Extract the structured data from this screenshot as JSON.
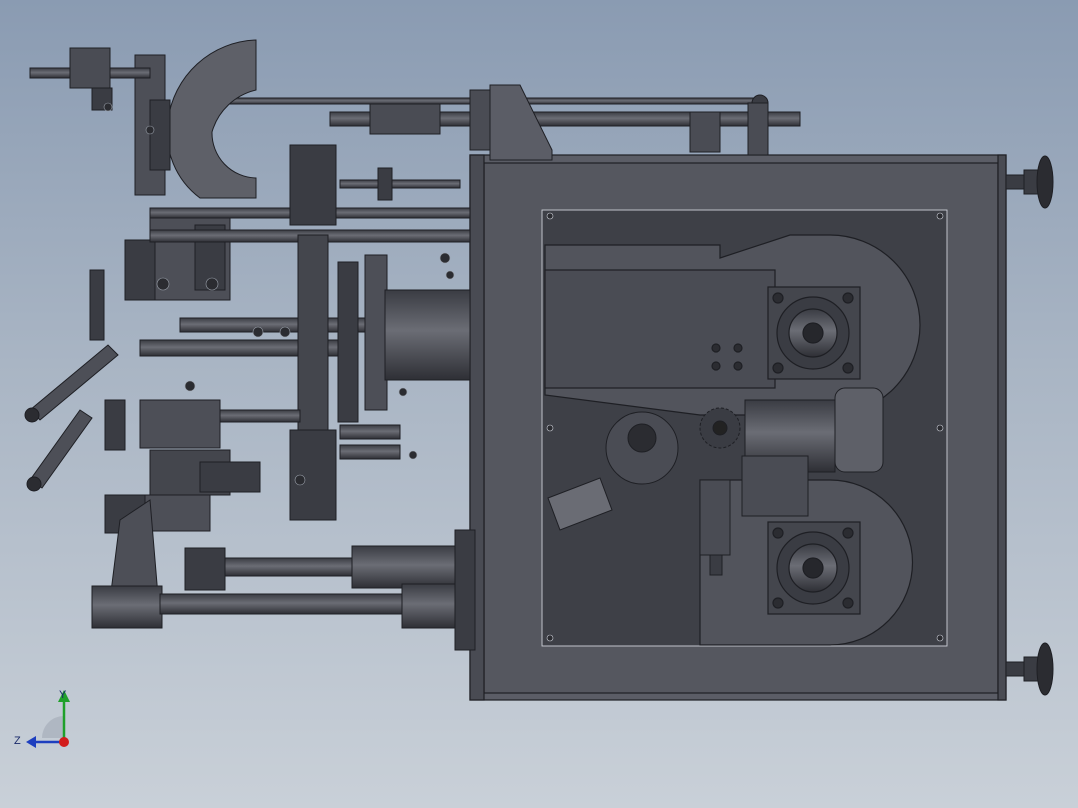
{
  "viewport": {
    "background_top": "#8a9bb2",
    "background_bottom": "#c9d0d8"
  },
  "model": {
    "part_color": "#4d4f57",
    "part_light": "#6a6c74",
    "part_dark": "#2b2c31"
  },
  "triad": {
    "y_label": "Y",
    "z_label": "Z",
    "y_color": "#1fa02a",
    "z_color": "#1e3fbf",
    "x_color": "#d21c1c"
  }
}
